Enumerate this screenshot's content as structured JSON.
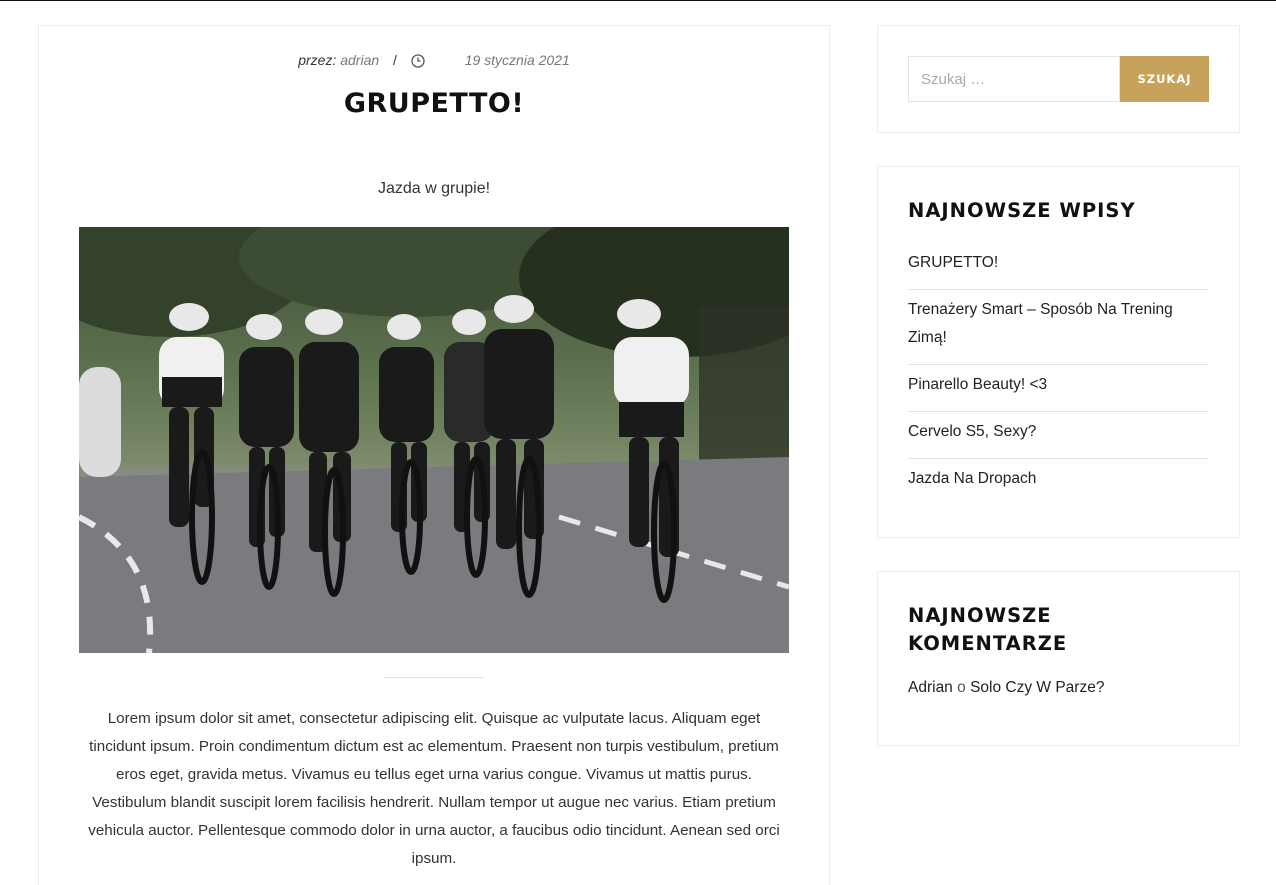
{
  "article": {
    "meta": {
      "by_label": "przez:",
      "author": "adrian",
      "separator": "/",
      "date": "19 stycznia 2021",
      "clock_icon": "clock-icon"
    },
    "title": "GRUPETTO!",
    "lead": "Jazda w grupie!",
    "body": "Lorem ipsum dolor sit amet, consectetur adipiscing elit. Quisque ac vulputate lacus. Aliquam eget tincidunt ipsum. Proin condimentum dictum est ac elementum. Praesent non turpis vestibulum, pretium eros eget, gravida metus. Vivamus eu tellus eget urna varius congue. Vivamus ut mattis purus. Vestibulum blandit suscipit lorem facilisis hendrerit. Nullam tempor ut augue nec varius. Etiam pretium vehicula auctor. Pellentesque commodo dolor in urna auctor, a faucibus odio tincidunt. Aenean sed orci ipsum."
  },
  "sidebar": {
    "search": {
      "placeholder": "Szukaj …",
      "button": "SZUKAJ"
    },
    "recent_posts": {
      "title": "NAJNOWSZE WPISY",
      "items": [
        "GRUPETTO!",
        "Trenażery Smart – Sposób Na Trening Zimą!",
        "Pinarello Beauty! <3",
        "Cervelo S5, Sexy?",
        "Jazda Na Dropach"
      ]
    },
    "recent_comments": {
      "title": "NAJNOWSZE KOMENTARZE",
      "author": "Adrian",
      "connector": "o",
      "post": "Solo Czy W Parze?"
    }
  },
  "colors": {
    "accent": "#c6a25a",
    "text": "#333333",
    "title": "#111111"
  }
}
